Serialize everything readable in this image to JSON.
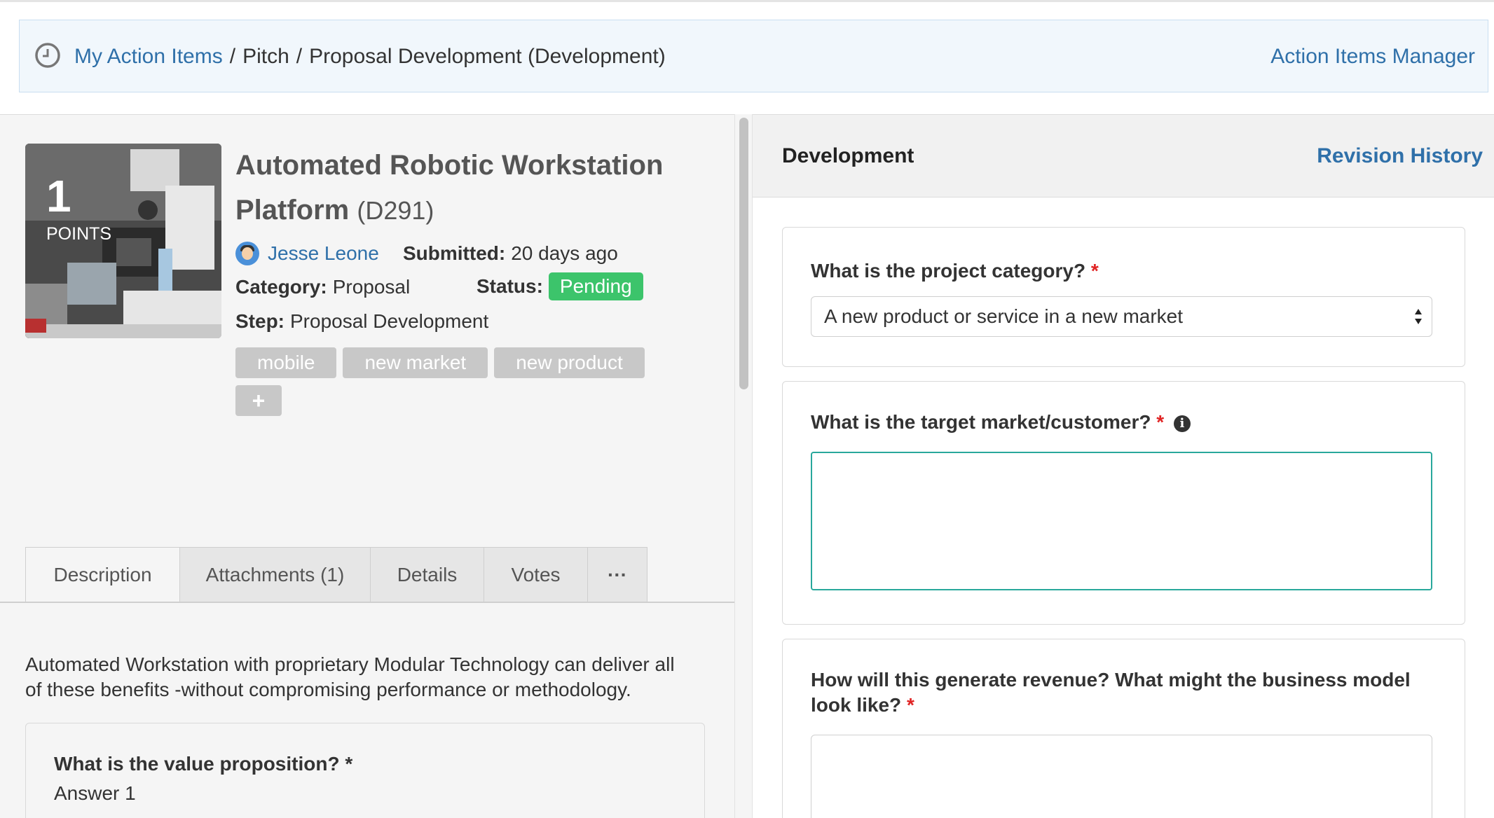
{
  "breadcrumb": {
    "root_link": "My Action Items",
    "separator": "/",
    "parts": [
      "Pitch",
      "Proposal Development (Development)"
    ],
    "manager_link": "Action Items Manager"
  },
  "idea": {
    "points_value": "1",
    "points_label": "POINTS",
    "title": "Automated Robotic Workstation Platform",
    "code": "(D291)",
    "author": "Jesse Leone",
    "submitted_label": "Submitted:",
    "submitted_value": "20 days ago",
    "category_label": "Category:",
    "category_value": "Proposal",
    "status_label": "Status:",
    "status_value": "Pending",
    "step_label": "Step:",
    "step_value": "Proposal Development",
    "tags": [
      "mobile",
      "new market",
      "new product"
    ],
    "add_tag": "+"
  },
  "tabs": [
    {
      "label": "Description",
      "active": true
    },
    {
      "label": "Attachments (1)"
    },
    {
      "label": "Details"
    },
    {
      "label": "Votes"
    },
    {
      "label": "···"
    }
  ],
  "description": {
    "text": "Automated Workstation with proprietary Modular Technology can deliver all of these benefits -without compromising performance or methodology.",
    "value_prop_question": "What is the value proposition? *",
    "value_prop_answer": "Answer 1"
  },
  "right": {
    "title": "Development",
    "revision_link": "Revision History",
    "q1": {
      "label": "What is the project category?",
      "required": "*",
      "selected": "A new product or service in a new market"
    },
    "q2": {
      "label": "What is the target market/customer?",
      "required": "*",
      "info": "i",
      "value": ""
    },
    "q3": {
      "label_line1": "How will this generate revenue? What might the business model",
      "label_line2": "look like?",
      "required": "*",
      "value": ""
    }
  },
  "colors": {
    "link": "#2f70a9",
    "pending": "#3cc46b",
    "required": "#e02424",
    "focus_border": "#29a89c"
  }
}
